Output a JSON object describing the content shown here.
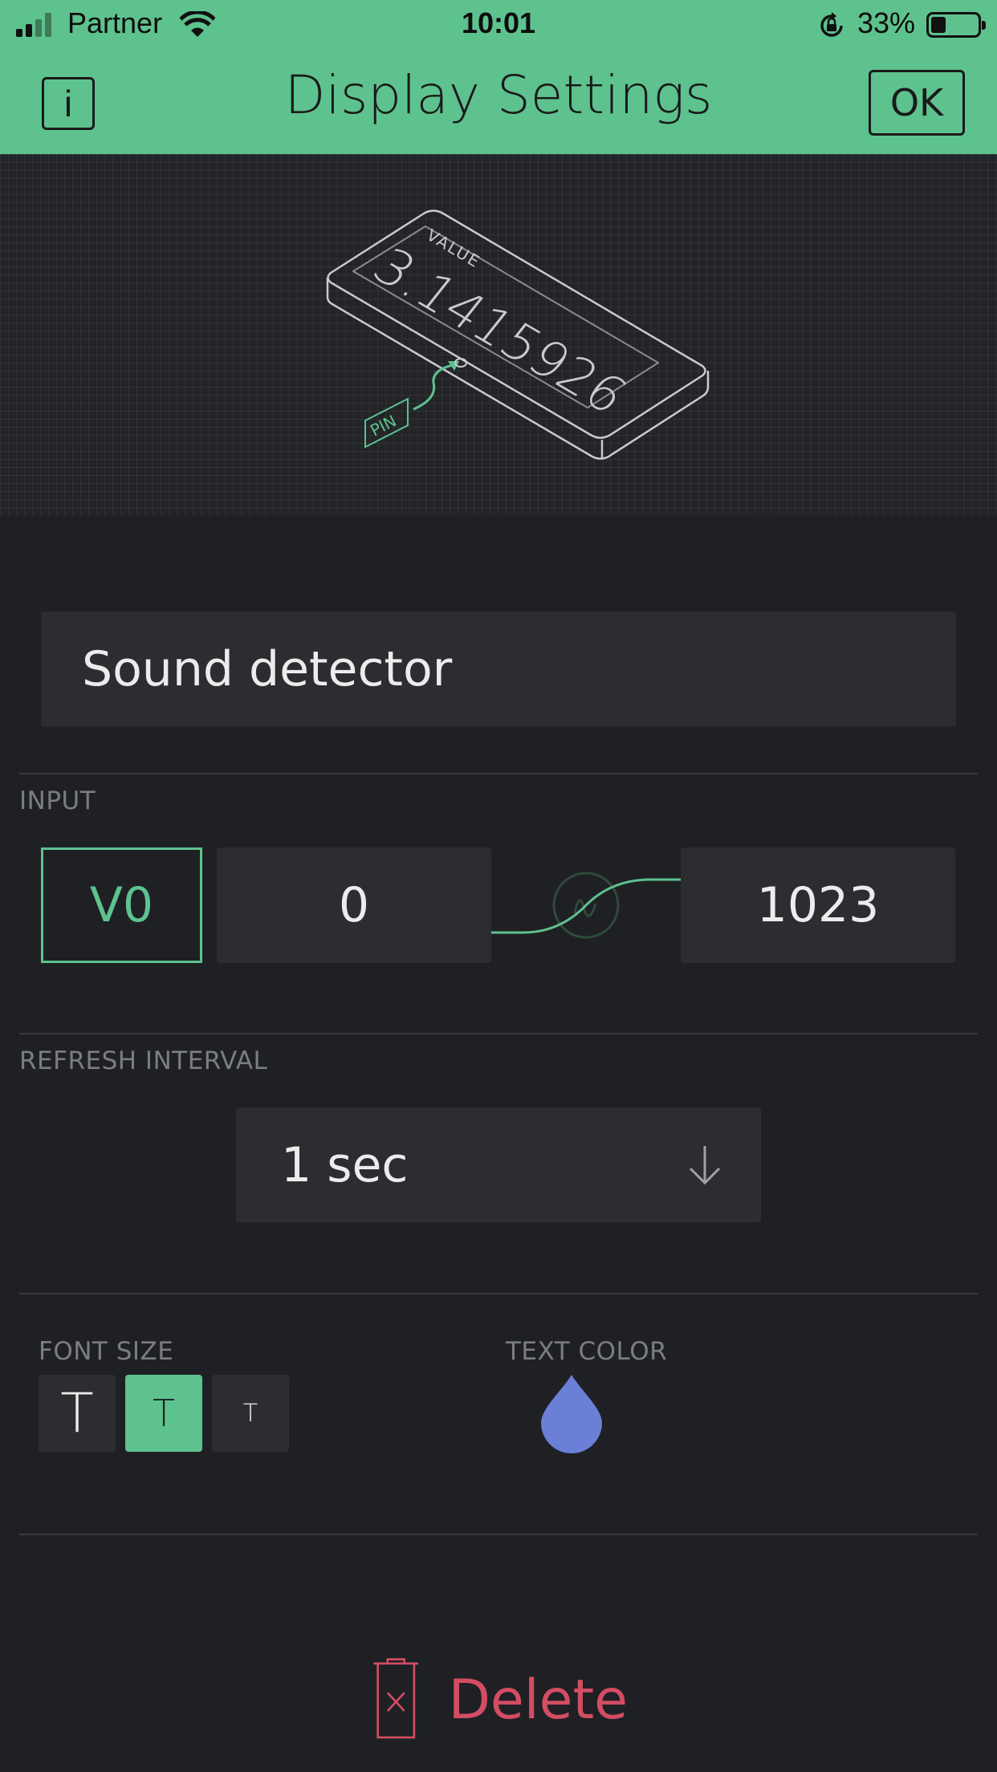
{
  "status_bar": {
    "carrier": "Partner",
    "time": "10:01",
    "battery_percent": "33%",
    "battery_level": 0.33
  },
  "header": {
    "info_label": "i",
    "title": "Display Settings",
    "ok_label": "OK"
  },
  "preview": {
    "value_label": "VALUE",
    "value_text": "3.1415926",
    "pin_label": "PIN"
  },
  "widget": {
    "name": "Sound detector"
  },
  "input": {
    "section_label": "INPUT",
    "pin": "V0",
    "min": "0",
    "max": "1023"
  },
  "refresh": {
    "section_label": "REFRESH INTERVAL",
    "selected": "1 sec"
  },
  "font_size": {
    "section_label": "FONT SIZE",
    "options": [
      "T",
      "T",
      "T"
    ],
    "selected_index": 1
  },
  "text_color": {
    "section_label": "TEXT COLOR",
    "color": "#6b7fd6"
  },
  "delete": {
    "label": "Delete"
  },
  "colors": {
    "accent": "#5dc28e",
    "background": "#1f2024",
    "field": "#2c2d31",
    "danger": "#d24d63"
  }
}
